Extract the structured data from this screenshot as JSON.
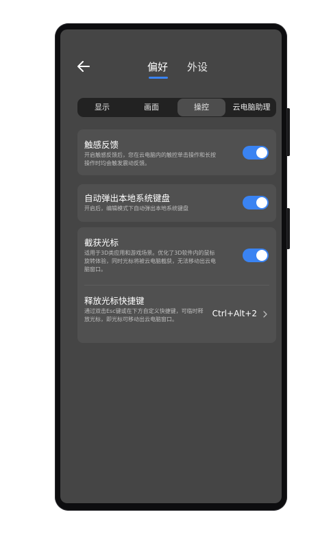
{
  "header": {
    "tabs": [
      {
        "label": "偏好",
        "active": true
      },
      {
        "label": "外设",
        "active": false
      }
    ]
  },
  "segments": [
    {
      "label": "显示",
      "active": false
    },
    {
      "label": "画面",
      "active": false
    },
    {
      "label": "操控",
      "active": true
    },
    {
      "label": "云电脑助理",
      "active": false
    }
  ],
  "settings": {
    "haptic": {
      "title": "触感反馈",
      "desc": "开启触感反馈后，您在云电脑内的触控单击操作和长按操作时均会触发震动反馈。",
      "enabled": true
    },
    "keyboard": {
      "title": "自动弹出本地系统键盘",
      "desc": "开启后，编辑模式下自动弹出本地系统键盘",
      "enabled": true
    },
    "capture": {
      "title": "截获光标",
      "desc": "适用于3D类应用和游戏场景。优化了3D软件内的鼠标旋转体验，同时光标将被云电脑截获，无法移动出云电脑窗口。",
      "enabled": true
    },
    "release": {
      "title": "释放光标快捷键",
      "desc": "通过双击Esc键或在下方自定义快捷键，可临时释放光标，即光标可移动出云电脑窗口。",
      "value": "Ctrl+Alt+2"
    }
  },
  "colors": {
    "accent": "#3a83f2",
    "screen_bg": "#454545",
    "card_bg": "#505050"
  },
  "icons": {
    "back": "back-arrow-icon",
    "chevron": "chevron-right-icon"
  }
}
